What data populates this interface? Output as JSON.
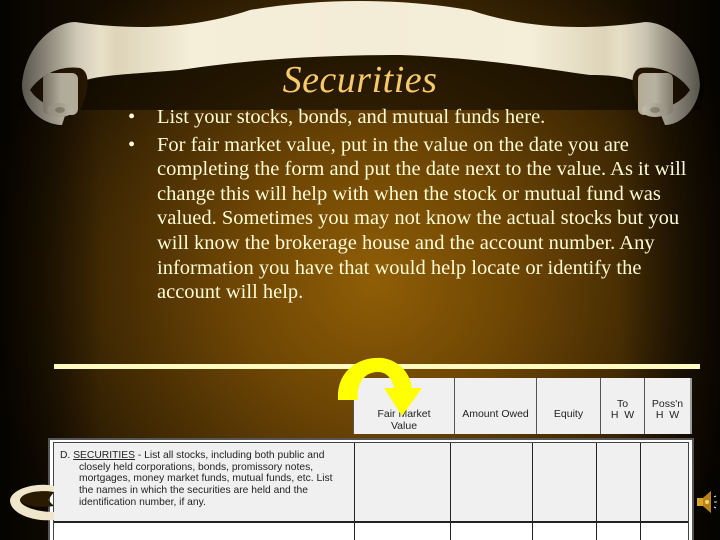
{
  "slide": {
    "title": "Securities",
    "bullets": [
      {
        "symbol": "•",
        "text": "List your stocks, bonds, and mutual funds here."
      },
      {
        "symbol": "•",
        "text": "For fair market value, put in the value on the date you are completing the form and put the date next to the value. As it will change this will help with when the stock or mutual fund was valued. Sometimes you may not know the actual stocks but you will know the brokerage house and the account number. Any information you have that would help locate or identify the account will help."
      }
    ]
  },
  "form_header": {
    "columns": [
      {
        "line1": "Fair Market",
        "line2": "Value"
      },
      {
        "line1": "Amount Owed",
        "line2": ""
      },
      {
        "line1": "Equity",
        "line2": ""
      },
      {
        "line1": "To",
        "line2": "H  W"
      },
      {
        "line1": "Poss'n",
        "line2": "H  W"
      }
    ]
  },
  "form_section": {
    "label_prefix": "D.",
    "heading": "SECURITIES",
    "description_first": " - List all stocks, including both public and",
    "description_lines": [
      "closely held corporations, bonds, promissory notes,",
      "mortgages, money market funds, mutual funds, etc. List",
      "the names in which the securities are held and the",
      "identification number, if any."
    ]
  },
  "colors": {
    "title": "#f7c96a",
    "body_text": "#fffbd6",
    "rule": "#fffbc0",
    "arrow": "#ffff00",
    "background_center": "#8f5e06"
  },
  "icons": {
    "arrow": "curved-arrow-down-icon",
    "speaker": "speaker-sound-icon"
  }
}
